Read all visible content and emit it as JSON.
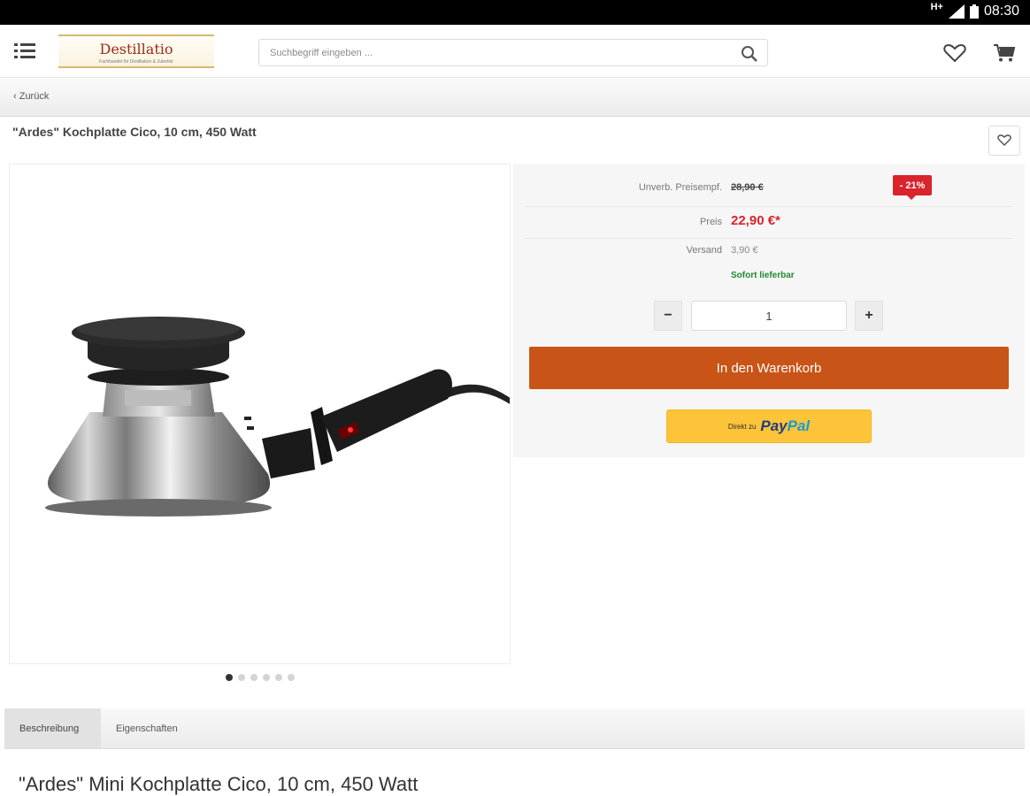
{
  "status_bar": {
    "network": "H+",
    "time": "08:30"
  },
  "header": {
    "menu_icon": "list-menu-icon",
    "logo_text": "Destillatio",
    "logo_subtext": "Fachhandel für Destillation & Zubehör",
    "search_placeholder": "Suchbegriff eingeben ...",
    "search_icon": "search-icon",
    "wishlist_icon": "heart-icon",
    "cart_icon": "cart-icon"
  },
  "navigation": {
    "back_label": "‹ Zurück"
  },
  "product": {
    "title": "\"Ardes\" Kochplatte Cico, 10 cm, 450 Watt",
    "note_icon": "heart-note-icon",
    "image_alt": "Ardes Kochplatte Cico",
    "gallery_count": 6,
    "gallery_active_index": 0
  },
  "buybox": {
    "rrp_label": "Unverb. Preisempf.",
    "rrp_value": "28,90 €",
    "discount_badge": "- 21%",
    "price_label": "Preis",
    "price_value": "22,90 €*",
    "shipping_label": "Versand",
    "shipping_value": "3,90 €",
    "availability": "Sofort lieferbar",
    "qty_minus": "−",
    "qty_value": "1",
    "qty_plus": "+",
    "cart_button": "In den Warenkorb",
    "paypal_prefix": "Direkt zu",
    "paypal_pay": "Pay",
    "paypal_pal": "Pal"
  },
  "tabs": [
    {
      "label": "Beschreibung",
      "active": true
    },
    {
      "label": "Eigenschaften",
      "active": false
    }
  ],
  "description": {
    "heading": "\"Ardes\" Mini Kochplatte Cico, 10 cm, 450 Watt"
  },
  "colors": {
    "accent": "#c95417",
    "price_red": "#d9232d",
    "availability_green": "#1f8a2e",
    "paypal_yellow": "#fec439"
  }
}
